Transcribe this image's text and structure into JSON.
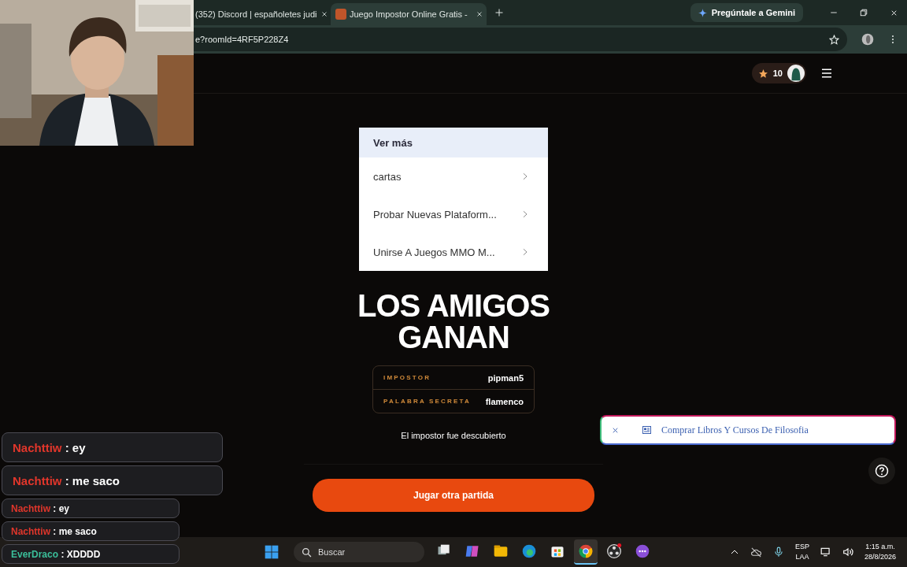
{
  "browser": {
    "tabs": [
      {
        "title": "(352) Discord | españoletes judi",
        "selected": false
      },
      {
        "title": "Juego Impostor Online Gratis -",
        "selected": true
      }
    ],
    "gemini_button": "Pregúntale a Gemini",
    "address": "e?roomId=4RF5P228Z4"
  },
  "header": {
    "coins": "10"
  },
  "dropdown": {
    "title": "Ver más",
    "items": [
      "cartas",
      "Probar Nuevas Plataform...",
      "Unirse A Juegos MMO M..."
    ]
  },
  "result": {
    "title": "LOS AMIGOS GANAN",
    "details": [
      {
        "label": "IMPOSTOR",
        "value": "pipman5"
      },
      {
        "label": "PALABRA SECRETA",
        "value": "flamenco"
      }
    ],
    "message": "El impostor fue descubierto",
    "button": "Jugar otra partida"
  },
  "ad": {
    "text": "Comprar Libros Y Cursos De Filosofia"
  },
  "chat": [
    {
      "user": "Nachttiw",
      "message": ": ey",
      "kind": "large",
      "color": "#e0362b"
    },
    {
      "user": "Nachttiw",
      "message": ": me saco",
      "kind": "large",
      "color": "#e0362b"
    },
    {
      "user": "Nachttiw",
      "message": ": ey",
      "kind": "small",
      "color": "#e0362b"
    },
    {
      "user": "Nachttiw",
      "message": ": me saco",
      "kind": "small",
      "color": "#e0362b"
    },
    {
      "user": "EverDraco",
      "message": ": XDDDD",
      "kind": "small",
      "color": "#3bbf9a"
    }
  ],
  "taskbar": {
    "search_placeholder": "Buscar",
    "apps": [
      {
        "kind": "taskview",
        "selected": false
      },
      {
        "kind": "copilot",
        "selected": false
      },
      {
        "kind": "files",
        "selected": false
      },
      {
        "kind": "edge",
        "selected": false
      },
      {
        "kind": "store",
        "selected": false
      },
      {
        "kind": "chrome",
        "selected": true
      },
      {
        "kind": "obs",
        "selected": false
      },
      {
        "kind": "messenger",
        "selected": false
      }
    ],
    "language": [
      "ESP",
      "LAA"
    ],
    "time": "1:15 a.m.",
    "date": "28/8/2026"
  }
}
